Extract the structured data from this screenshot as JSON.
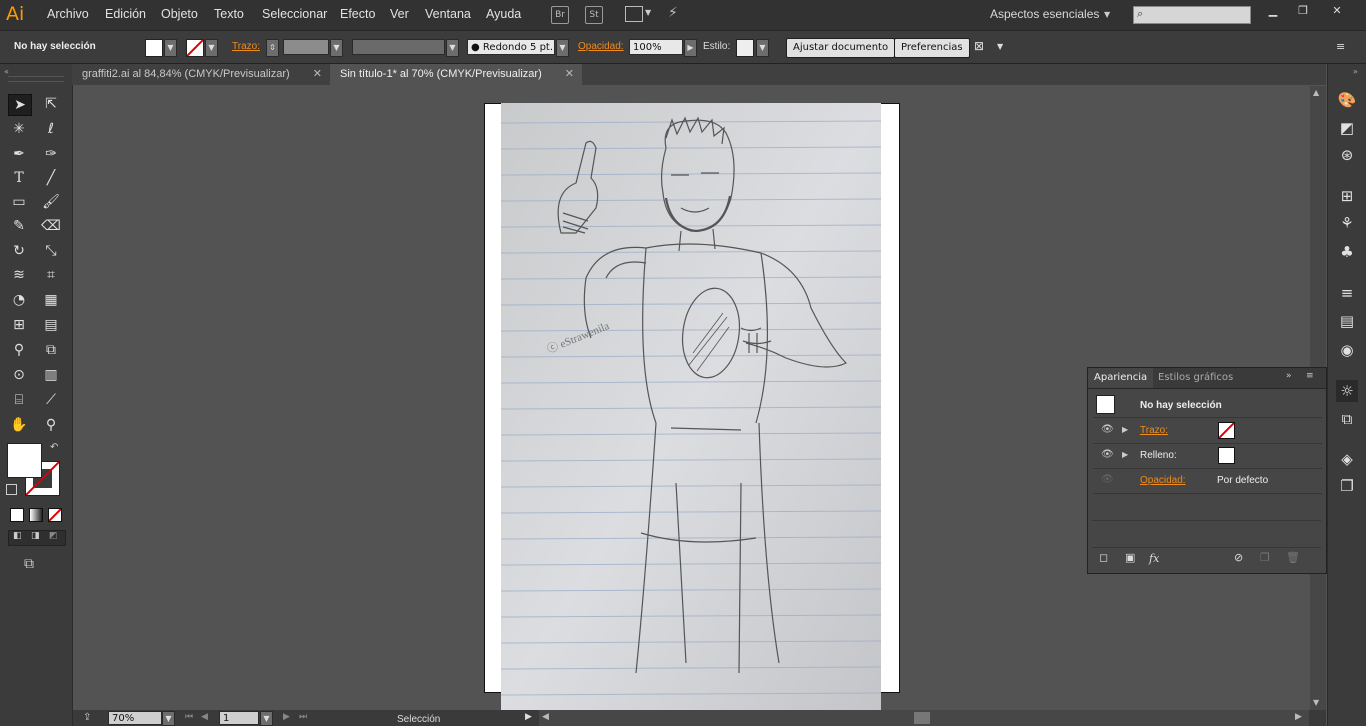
{
  "app": {
    "logo": "Ai"
  },
  "menu": [
    "Archivo",
    "Edición",
    "Objeto",
    "Texto",
    "Seleccionar",
    "Efecto",
    "Ver",
    "Ventana",
    "Ayuda"
  ],
  "menubar_buttons": {
    "bridge": "Br",
    "stock": "St"
  },
  "workspace_label": "Aspectos esenciales",
  "control": {
    "selection_status": "No hay selección",
    "stroke_label": "Trazo:",
    "brush_label": "Redondo 5 pt.",
    "opacity_label": "Opacidad:",
    "opacity_value": "100%",
    "style_label": "Estilo:",
    "fit_document_button": "Ajustar documento",
    "preferences_button": "Preferencias"
  },
  "tabs": [
    {
      "label": "graffiti2.ai al 84,84% (CMYK/Previsualizar)",
      "active": false
    },
    {
      "label": "Sin título-1* al 70% (CMYK/Previsualizar)",
      "active": true
    }
  ],
  "status": {
    "zoom": "70%",
    "artboard": "1",
    "tool": "Selección"
  },
  "appearance": {
    "tabs": [
      "Apariencia",
      "Estilos gráficos"
    ],
    "header": "No hay selección",
    "rows": [
      {
        "label": "Trazo:",
        "value": ""
      },
      {
        "label": "Relleno:",
        "value": ""
      },
      {
        "label": "Opacidad:",
        "value": "Por defecto"
      }
    ],
    "fx": "fx"
  },
  "colors": {
    "accent": "#ff9a00",
    "link": "#f08c1e",
    "panel": "#464646",
    "chrome": "#323232"
  }
}
